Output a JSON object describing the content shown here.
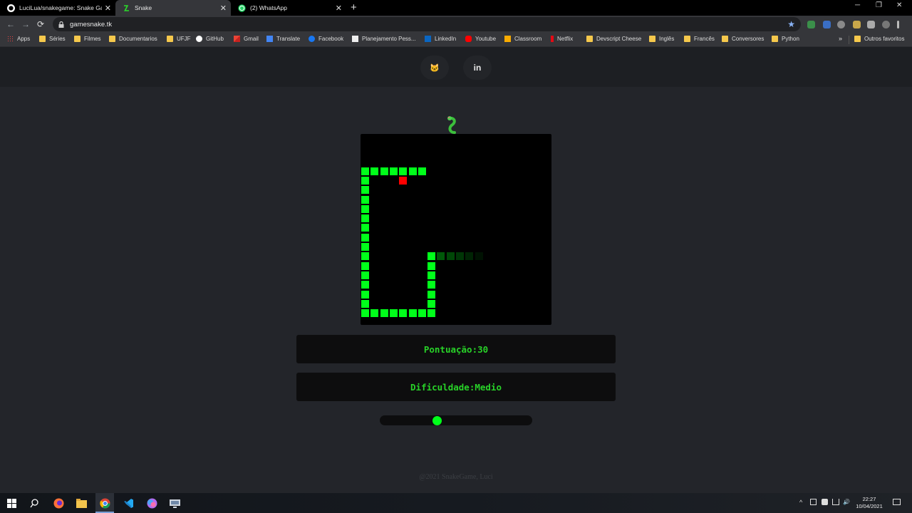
{
  "browser": {
    "tabs": [
      {
        "label": "LuciLua/snakegame: Snake Game",
        "close": "✕",
        "active": false
      },
      {
        "label": "Snake",
        "close": "✕",
        "active": true
      },
      {
        "label": "(2) WhatsApp",
        "close": "✕",
        "active": false
      }
    ],
    "new_tab": "+",
    "window_controls": {
      "minimize": "─",
      "restore": "❐",
      "close": "✕"
    },
    "nav": {
      "back": "←",
      "forward": "→",
      "reload": "⟳"
    },
    "url": "gamesnake.tk",
    "bookmark_star": "★",
    "bookmarks": [
      {
        "label": "Apps",
        "icon": "apps-grid-icon"
      },
      {
        "label": "Séries",
        "icon": "folder-icon"
      },
      {
        "label": "Filmes",
        "icon": "folder-icon"
      },
      {
        "label": "Documentarios",
        "icon": "folder-icon"
      },
      {
        "label": "UFJF",
        "icon": "folder-icon"
      },
      {
        "label": "GitHub",
        "icon": "github-icon"
      },
      {
        "label": "Gmail",
        "icon": "gmail-icon"
      },
      {
        "label": "Translate",
        "icon": "translate-icon"
      },
      {
        "label": "Facebook",
        "icon": "facebook-icon"
      },
      {
        "label": "Planejamento Pess...",
        "icon": "notion-icon"
      },
      {
        "label": "LinkedIn",
        "icon": "linkedin-icon"
      },
      {
        "label": "Youtube",
        "icon": "youtube-icon"
      },
      {
        "label": "Classroom",
        "icon": "classroom-icon"
      },
      {
        "label": "Netflix",
        "icon": "netflix-icon"
      },
      {
        "label": "Devscript Cheese",
        "icon": "folder-icon"
      },
      {
        "label": "Inglês",
        "icon": "folder-icon"
      },
      {
        "label": "Francês",
        "icon": "folder-icon"
      },
      {
        "label": "Conversores",
        "icon": "folder-icon"
      },
      {
        "label": "Python",
        "icon": "folder-icon"
      }
    ],
    "bookmarks_overflow": "»",
    "other_bookmarks": "Outros favoritos"
  },
  "header": {
    "social": [
      {
        "icon": "github-icon",
        "glyph": "🐱"
      },
      {
        "icon": "linkedin-icon",
        "glyph": "in"
      }
    ]
  },
  "game": {
    "score_text": "Pontuação:30",
    "difficulty_text": "Dificuldade:Medio",
    "difficulty_level": 0.37,
    "grid_cells": 20,
    "snake": [
      [
        0,
        2
      ],
      [
        1,
        2
      ],
      [
        2,
        2
      ],
      [
        3,
        2
      ],
      [
        4,
        2
      ],
      [
        5,
        2
      ],
      [
        6,
        2
      ],
      [
        0,
        3
      ],
      [
        0,
        4
      ],
      [
        0,
        5
      ],
      [
        0,
        6
      ],
      [
        0,
        7
      ],
      [
        0,
        8
      ],
      [
        0,
        9
      ],
      [
        0,
        10
      ],
      [
        0,
        11
      ],
      [
        0,
        12
      ],
      [
        0,
        13
      ],
      [
        0,
        14
      ],
      [
        0,
        15
      ],
      [
        0,
        16
      ],
      [
        0,
        17
      ],
      [
        1,
        17
      ],
      [
        2,
        17
      ],
      [
        3,
        17
      ],
      [
        4,
        17
      ],
      [
        5,
        17
      ],
      [
        6,
        17
      ],
      [
        7,
        17
      ],
      [
        7,
        16
      ],
      [
        7,
        15
      ],
      [
        7,
        14
      ],
      [
        7,
        13
      ],
      [
        7,
        12
      ],
      [
        7,
        11
      ]
    ],
    "trail": [
      [
        8,
        11
      ],
      [
        9,
        11
      ],
      [
        10,
        11
      ],
      [
        11,
        11
      ],
      [
        12,
        11
      ]
    ],
    "food": [
      4,
      3
    ],
    "colors": {
      "snake": "#00ff1a",
      "food": "#ff0000",
      "board": "#000000",
      "text": "#28d228"
    }
  },
  "footer": {
    "text": "@2021 SnakeGame, Luci"
  },
  "taskbar": {
    "apps": [
      "windows-start-icon",
      "search-icon",
      "firefox-icon",
      "file-explorer-icon",
      "chrome-icon",
      "vscode-icon",
      "color-app-icon",
      "monitor-app-icon"
    ],
    "tray": {
      "expand": "^",
      "volume": "🔊"
    },
    "time": "22:27",
    "date": "10/04/2021"
  }
}
